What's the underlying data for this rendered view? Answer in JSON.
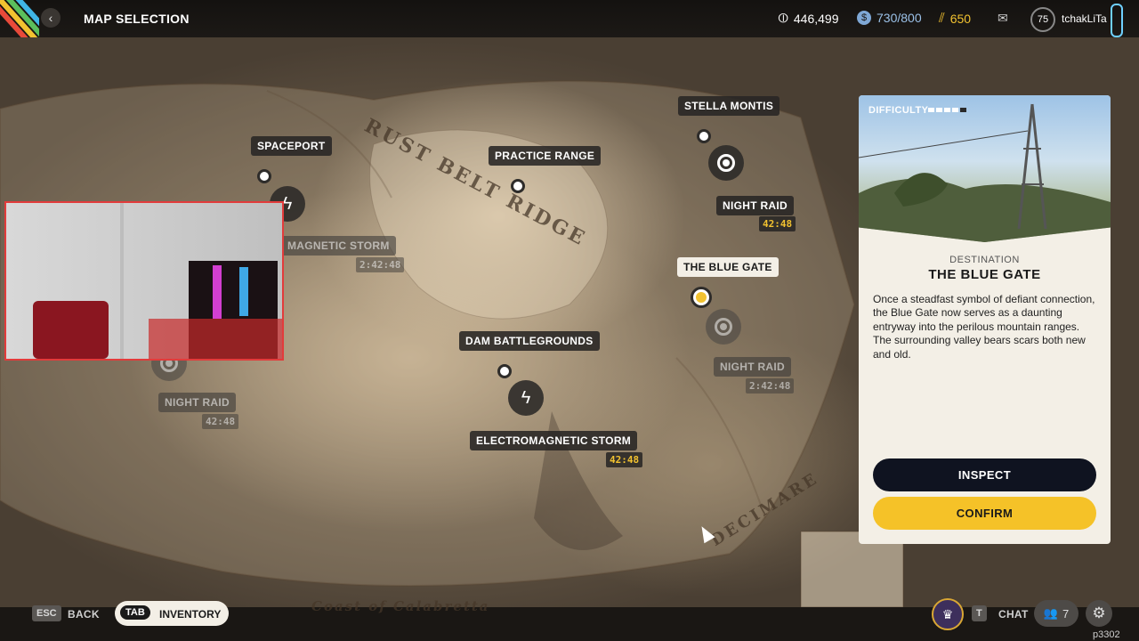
{
  "header": {
    "title": "MAP SELECTION",
    "currency_1": "446,499",
    "currency_2": "730/800",
    "currency_3": "650",
    "player_level": "75",
    "username": "tchakLiTa",
    "icons": [
      "back-arrow-icon",
      "coin-icon",
      "seed-icon",
      "tokens-icon",
      "mail-icon"
    ]
  },
  "map": {
    "region_labels": [
      "RUST BELT RIDGE",
      "DECIMARE",
      "Coast of Calabretta"
    ],
    "locations": [
      {
        "name": "SPACEPORT"
      },
      {
        "name": "PRACTICE RANGE"
      },
      {
        "name": "STELLA MONTIS"
      },
      {
        "name": "THE BLUE GATE"
      },
      {
        "name": "DAM BATTLEGROUNDS"
      }
    ],
    "events": [
      {
        "name": "NIGHT RAID",
        "timer": "42:48"
      },
      {
        "name": "NIGHT RAID",
        "timer": "2:42:48"
      },
      {
        "name": "NIGHT RAID",
        "timer": "42:48"
      },
      {
        "name": "ELECTROMAGNETIC STORM",
        "timer": "42:48"
      },
      {
        "name": "MAGNETIC STORM",
        "timer": "2:42:48"
      }
    ]
  },
  "panel": {
    "difficulty_label": "DIFFICULTY",
    "difficulty_level": 4,
    "difficulty_max": 5,
    "destination_label": "DESTINATION",
    "destination_name": "THE BLUE GATE",
    "description": "Once a steadfast symbol of defiant connection, the Blue Gate now serves as a daunting entryway into the perilous mountain ranges. The surrounding valley bears scars both new and old.",
    "inspect_label": "INSPECT",
    "confirm_label": "CONFIRM"
  },
  "footer": {
    "esc_key": "ESC",
    "back_label": "BACK",
    "tab_key": "TAB",
    "inventory_label": "INVENTORY",
    "chat_key": "T",
    "chat_label": "CHAT",
    "party_count": "7",
    "version": "p3302"
  }
}
